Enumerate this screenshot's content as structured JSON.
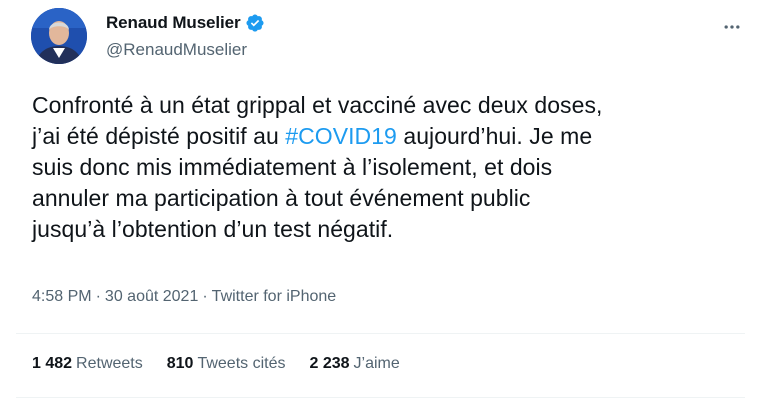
{
  "author": {
    "display_name": "Renaud Muselier",
    "handle": "@RenaudMuselier",
    "verified": true,
    "verified_icon": "verified-badge-icon",
    "avatar_icon": "avatar"
  },
  "more_icon": "more-horizontal-icon",
  "tweet": {
    "text_before": "Confronté à un état grippal et vacciné avec deux doses,\nj’ai été dépisté positif au ",
    "hashtag": "#COVID19",
    "text_after": " aujourd’hui. Je me\nsuis donc mis immédiatement à l’isolement, et dois\nannuler ma participation à tout événement public\njusqu’à l’obtention d’un test négatif."
  },
  "meta": {
    "time": "4:58 PM",
    "separator": "·",
    "date": "30 août 2021",
    "source": "Twitter for iPhone"
  },
  "stats": {
    "retweets": {
      "count": "1 482",
      "label": "Retweets"
    },
    "quotes": {
      "count": "810",
      "label": "Tweets cités"
    },
    "likes": {
      "count": "2 238",
      "label": "J’aime"
    }
  },
  "colors": {
    "link": "#1d9bf0",
    "secondary_text": "#536471",
    "primary_text": "#0f1419",
    "divider": "#eff3f4"
  }
}
